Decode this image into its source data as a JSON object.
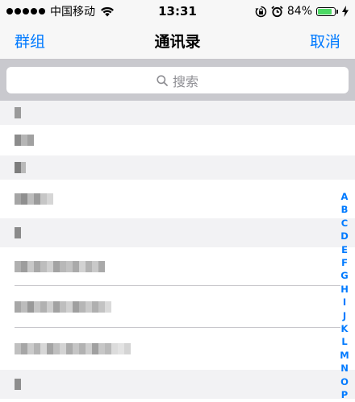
{
  "status_bar": {
    "carrier": "中国移动",
    "time": "13:31",
    "battery_percent": "84%",
    "battery_level": 0.84,
    "battery_color": "#4cd964",
    "icons": [
      "signal-dots-icon",
      "wifi-icon",
      "orientation-lock-icon",
      "alarm-icon",
      "charging-bolt-icon"
    ]
  },
  "nav": {
    "left_label": "群组",
    "title": "通讯录",
    "right_label": "取消",
    "accent": "#007aff"
  },
  "search": {
    "placeholder": "搜索"
  },
  "index_letters": [
    "A",
    "B",
    "C",
    "D",
    "E",
    "F",
    "G",
    "H",
    "I",
    "J",
    "K",
    "L",
    "M",
    "N",
    "O",
    "P"
  ]
}
